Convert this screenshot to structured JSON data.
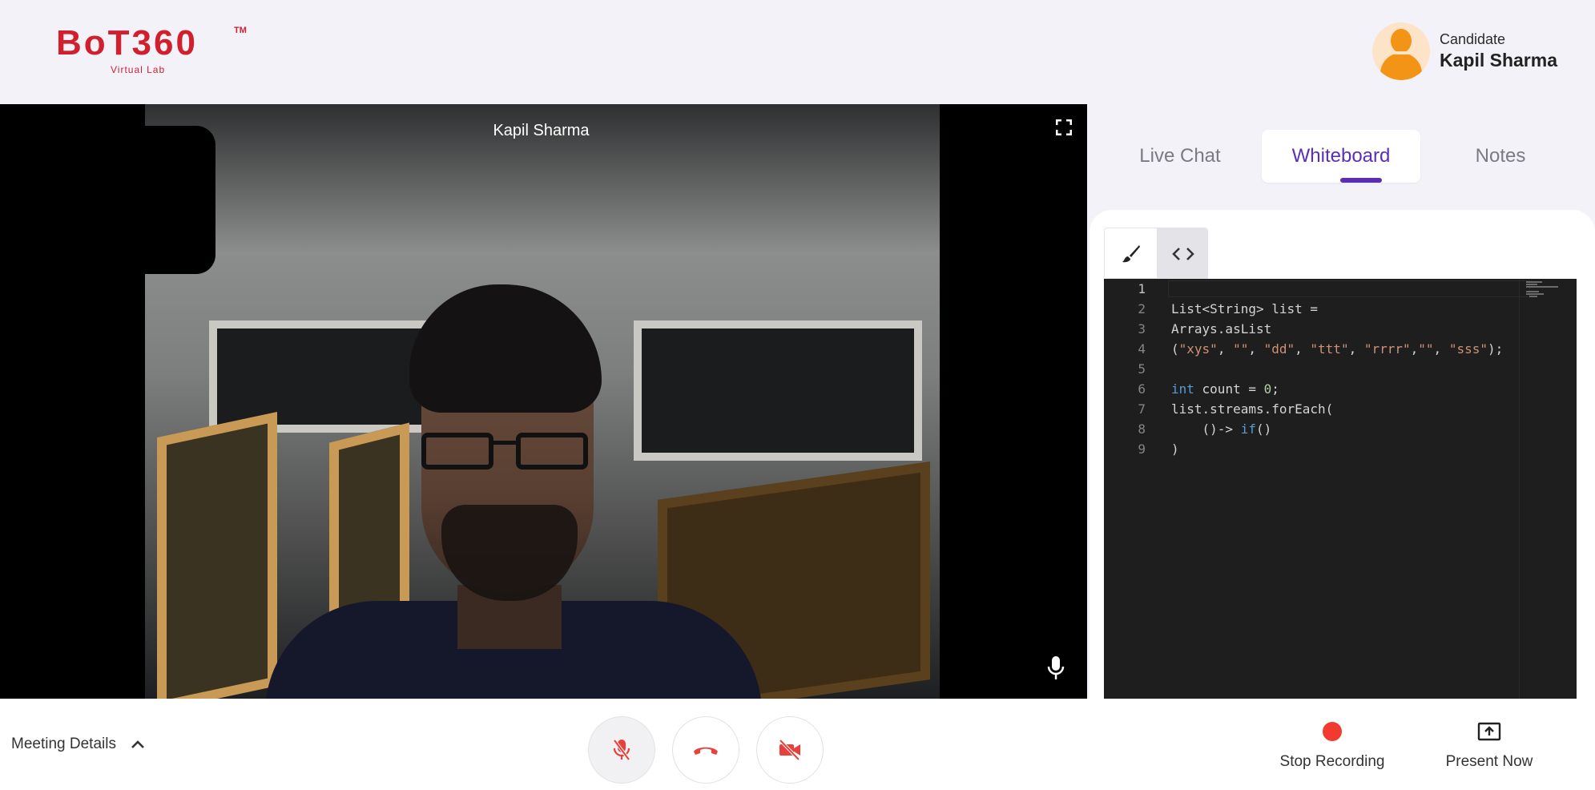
{
  "brand": {
    "logo_text": "BoT360",
    "trademark": "TM",
    "tagline": "Virtual Lab",
    "brand_color": "#d21f2e"
  },
  "user": {
    "role": "Candidate",
    "name": "Kapil Sharma"
  },
  "video": {
    "participant_name": "Kapil Sharma",
    "icons": [
      "fullscreen-icon",
      "microphone-icon"
    ]
  },
  "tabs": {
    "items": [
      {
        "label": "Live Chat",
        "active": false
      },
      {
        "label": "Whiteboard",
        "active": true
      },
      {
        "label": "Notes",
        "active": false
      }
    ],
    "accent_color": "#5b2fb3"
  },
  "whiteboard": {
    "mode_tools": [
      "brush-icon",
      "code-icon"
    ],
    "active_mode": "code",
    "code_lines": [
      {
        "n": "1",
        "text": ""
      },
      {
        "n": "2",
        "text": "List<String> list ="
      },
      {
        "n": "3",
        "text": "Arrays.asList"
      },
      {
        "n": "4",
        "text": "(\"xys\", \"\", \"dd\", \"ttt\", \"rrrr\",\"\", \"sss\");"
      },
      {
        "n": "5",
        "text": ""
      },
      {
        "n": "6",
        "text": "int count = 0;"
      },
      {
        "n": "7",
        "text": "list.streams.forEach("
      },
      {
        "n": "8",
        "text": "    ()-> if()"
      },
      {
        "n": "9",
        "text": ")"
      }
    ]
  },
  "bottom_bar": {
    "meeting_details_label": "Meeting Details",
    "controls": [
      "mic-off-icon",
      "end-call-icon",
      "video-off-icon"
    ],
    "stop_recording_label": "Stop Recording",
    "present_now_label": "Present Now",
    "recording_color": "#f23b30"
  }
}
